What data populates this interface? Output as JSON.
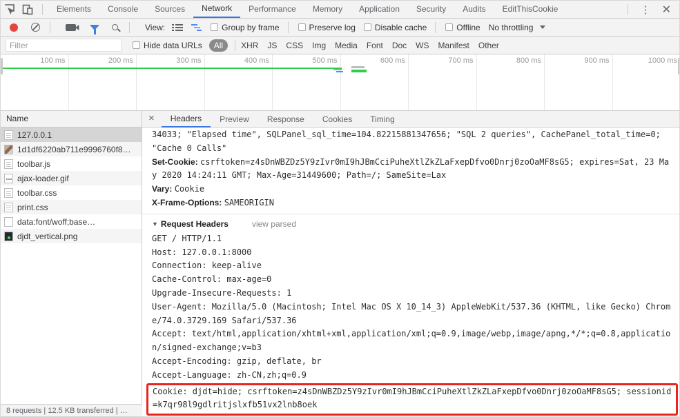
{
  "window": {
    "tabs": [
      "Elements",
      "Console",
      "Sources",
      "Network",
      "Performance",
      "Memory",
      "Application",
      "Security",
      "Audits",
      "EditThisCookie"
    ],
    "active_tab": "Network"
  },
  "network_toolbar": {
    "view_label": "View:",
    "group_by_frame": "Group by frame",
    "preserve_log": "Preserve log",
    "disable_cache": "Disable cache",
    "offline": "Offline",
    "throttling": "No throttling"
  },
  "filter_bar": {
    "filter_placeholder": "Filter",
    "hide_data_urls": "Hide data URLs",
    "type_filters": [
      "All",
      "XHR",
      "JS",
      "CSS",
      "Img",
      "Media",
      "Font",
      "Doc",
      "WS",
      "Manifest",
      "Other"
    ],
    "selected_type": "All"
  },
  "overview": {
    "ticks": [
      "100 ms",
      "200 ms",
      "300 ms",
      "400 ms",
      "500 ms",
      "600 ms",
      "700 ms",
      "800 ms",
      "900 ms",
      "1000 ms"
    ],
    "timeline_color": "#2fce4e"
  },
  "requests_panel": {
    "column_header": "Name",
    "rows": [
      {
        "name": "127.0.0.1",
        "icon": "document-icon",
        "selected": true
      },
      {
        "name": "1d1df6220ab711e9996760f8…",
        "icon": "image-icon",
        "selected": false
      },
      {
        "name": "toolbar.js",
        "icon": "document-icon",
        "selected": false
      },
      {
        "name": "ajax-loader.gif",
        "icon": "image-icon",
        "selected": false
      },
      {
        "name": "toolbar.css",
        "icon": "document-icon",
        "selected": false
      },
      {
        "name": "print.css",
        "icon": "document-icon",
        "selected": false
      },
      {
        "name": "data:font/woff;base…",
        "icon": "file-icon",
        "selected": false
      },
      {
        "name": "djdt_vertical.png",
        "icon": "image-icon",
        "selected": false
      }
    ],
    "status_bar": "8 requests | 12.5 KB transferred | …"
  },
  "detail_panel": {
    "tabs": [
      "Headers",
      "Preview",
      "Response",
      "Cookies",
      "Timing"
    ],
    "active_tab": "Headers",
    "response_headers": {
      "overflow_line": "34033; \"Elapsed time\", SQLPanel_sql_time=104.82215881347656; \"SQL 2 queries\", CachePanel_total_time=0; \"Cache 0 Calls\"",
      "items": [
        {
          "name": "Set-Cookie",
          "value": "csrftoken=z4sDnWBZDz5Y9zIvr0mI9hJBmCciPuheXtlZkZLaFxepDfvo0Dnrj0zoOaMF8sG5; expires=Sat, 23 May 2020 14:24:11 GMT; Max-Age=31449600; Path=/; SameSite=Lax"
        },
        {
          "name": "Vary",
          "value": "Cookie"
        },
        {
          "name": "X-Frame-Options",
          "value": "SAMEORIGIN"
        }
      ]
    },
    "request_headers": {
      "section_label": "Request Headers",
      "view_parsed_label": "view parsed",
      "source_lines": [
        "GET / HTTP/1.1",
        "Host: 127.0.0.1:8000",
        "Connection: keep-alive",
        "Cache-Control: max-age=0",
        "Upgrade-Insecure-Requests: 1",
        "User-Agent: Mozilla/5.0 (Macintosh; Intel Mac OS X 10_14_3) AppleWebKit/537.36 (KHTML, like Gecko) Chrome/74.0.3729.169 Safari/537.36",
        "Accept: text/html,application/xhtml+xml,application/xml;q=0.9,image/webp,image/apng,*/*;q=0.8,application/signed-exchange;v=b3",
        "Accept-Encoding: gzip, deflate, br",
        "Accept-Language: zh-CN,zh;q=0.9"
      ],
      "highlighted_line": "Cookie: djdt=hide; csrftoken=z4sDnWBZDz5Y9zIvr0mI9hJBmCciPuheXtlZkZLaFxepDfvo0Dnrj0zoOaMF8sG5; sessionid=k7qr98l9gdlritjslxfb51vx2lnb8oek",
      "highlight_color": "#e8251d"
    }
  }
}
